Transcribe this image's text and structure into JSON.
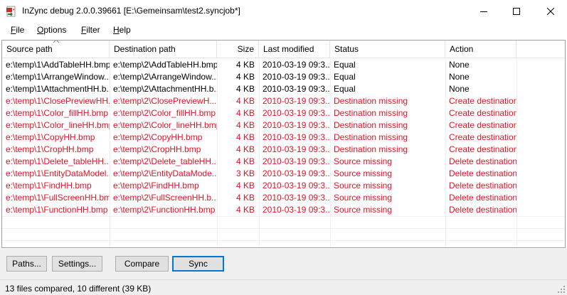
{
  "window": {
    "title": "InZync debug 2.0.0.39661 [E:\\Gemeinsam\\test2.syncjob*]"
  },
  "menu": [
    {
      "label_u": "F",
      "label_rest": "ile"
    },
    {
      "label_u": "O",
      "label_rest": "ptions"
    },
    {
      "label_u": "F",
      "label_rest": "ilter"
    },
    {
      "label_u": "H",
      "label_rest": "elp"
    }
  ],
  "columns": {
    "source": "Source path",
    "destination": "Destination path",
    "size": "Size",
    "modified": "Last modified",
    "status": "Status",
    "action": "Action"
  },
  "rows": [
    {
      "source": "e:\\temp\\1\\AddTableHH.bmp",
      "destination": "e:\\temp\\2\\AddTableHH.bmp",
      "size": "4 KB",
      "modified": "2010-03-19 09:3...",
      "status": "Equal",
      "action": "None",
      "state": "equal"
    },
    {
      "source": "e:\\temp\\1\\ArrangeWindow...",
      "destination": "e:\\temp\\2\\ArrangeWindow...",
      "size": "4 KB",
      "modified": "2010-03-19 09:3...",
      "status": "Equal",
      "action": "None",
      "state": "equal"
    },
    {
      "source": "e:\\temp\\1\\AttachmentHH.b...",
      "destination": "e:\\temp\\2\\AttachmentHH.b...",
      "size": "4 KB",
      "modified": "2010-03-19 09:3...",
      "status": "Equal",
      "action": "None",
      "state": "equal"
    },
    {
      "source": "e:\\temp\\1\\ClosePreviewHH...",
      "destination": "e:\\temp\\2\\ClosePreviewH...",
      "size": "4 KB",
      "modified": "2010-03-19 09:3...",
      "status": "Destination missing",
      "action": "Create destination",
      "state": "diff"
    },
    {
      "source": "e:\\temp\\1\\Color_fillHH.bmp",
      "destination": "e:\\temp\\2\\Color_fillHH.bmp",
      "size": "4 KB",
      "modified": "2010-03-19 09:3...",
      "status": "Destination missing",
      "action": "Create destination",
      "state": "diff"
    },
    {
      "source": "e:\\temp\\1\\Color_lineHH.bmp",
      "destination": "e:\\temp\\2\\Color_lineHH.bmp",
      "size": "4 KB",
      "modified": "2010-03-19 09:3...",
      "status": "Destination missing",
      "action": "Create destination",
      "state": "diff"
    },
    {
      "source": "e:\\temp\\1\\CopyHH.bmp",
      "destination": "e:\\temp\\2\\CopyHH.bmp",
      "size": "4 KB",
      "modified": "2010-03-19 09:3...",
      "status": "Destination missing",
      "action": "Create destination",
      "state": "diff"
    },
    {
      "source": "e:\\temp\\1\\CropHH.bmp",
      "destination": "e:\\temp\\2\\CropHH.bmp",
      "size": "4 KB",
      "modified": "2010-03-19 09:3...",
      "status": "Destination missing",
      "action": "Create destination",
      "state": "diff"
    },
    {
      "source": "e:\\temp\\1\\Delete_tableHH....",
      "destination": "e:\\temp\\2\\Delete_tableHH...",
      "size": "4 KB",
      "modified": "2010-03-19 09:3...",
      "status": "Source missing",
      "action": "Delete destination",
      "state": "diff"
    },
    {
      "source": "e:\\temp\\1\\EntityDataModel...",
      "destination": "e:\\temp\\2\\EntityDataMode...",
      "size": "3 KB",
      "modified": "2010-03-19 09:3...",
      "status": "Source missing",
      "action": "Delete destination",
      "state": "diff"
    },
    {
      "source": "e:\\temp\\1\\FindHH.bmp",
      "destination": "e:\\temp\\2\\FindHH.bmp",
      "size": "4 KB",
      "modified": "2010-03-19 09:3...",
      "status": "Source missing",
      "action": "Delete destination",
      "state": "diff"
    },
    {
      "source": "e:\\temp\\1\\FullScreenHH.bmp",
      "destination": "e:\\temp\\2\\FullScreenHH.b...",
      "size": "4 KB",
      "modified": "2010-03-19 09:3...",
      "status": "Source missing",
      "action": "Delete destination",
      "state": "diff"
    },
    {
      "source": "e:\\temp\\1\\FunctionHH.bmp",
      "destination": "e:\\temp\\2\\FunctionHH.bmp",
      "size": "4 KB",
      "modified": "2010-03-19 09:3...",
      "status": "Source missing",
      "action": "Delete destination",
      "state": "diff"
    }
  ],
  "buttons": {
    "paths": "Paths...",
    "settings": "Settings...",
    "compare": "Compare",
    "sync": "Sync"
  },
  "status": {
    "text": "13 files compared, 10 different (39 KB)"
  },
  "colors": {
    "different_text": "#e81123",
    "default_button_border": "#0078d7"
  }
}
